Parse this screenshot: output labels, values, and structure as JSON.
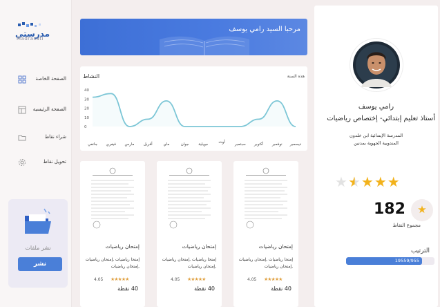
{
  "app": {
    "logo_text": "مدرستي",
    "logo_sub": "Madrasati"
  },
  "sidebar": {
    "items": [
      {
        "label": "الصفحة الخاصة",
        "icon": "grid-icon"
      },
      {
        "label": "الصفحة الرئيسية",
        "icon": "layout-icon"
      },
      {
        "label": "شراء نقاط",
        "icon": "folder-icon"
      },
      {
        "label": "تحويل نقاط",
        "icon": "gear-icon"
      }
    ],
    "upload": {
      "label": "نشر ملفات",
      "button": "نشر"
    }
  },
  "banner": {
    "title": "مرحبا السيد رامي يوسف"
  },
  "activity": {
    "title": "النشاط",
    "filter": "هذه السنة"
  },
  "chart_data": {
    "type": "area",
    "title": "النشاط",
    "categories": [
      "ديسمبر",
      "نوفمبر",
      "أكتوبر",
      "سبتمبر",
      "أوت",
      "جويلية",
      "جوان",
      "ماي",
      "أفريل",
      "مارس",
      "فيفري",
      "جانفي"
    ],
    "values": [
      0,
      28,
      8,
      0,
      0,
      0,
      0,
      28,
      8,
      0,
      36,
      32
    ],
    "yticks": [
      0,
      10,
      20,
      30,
      40
    ],
    "ylim": [
      0,
      40
    ],
    "color": "#7cc6d6",
    "grid": false
  },
  "documents": [
    {
      "title": "إمتحان رياضيات",
      "description": "إمتحا رياضيات ,إمتحان رياضيات ,إمتحان رياضيات",
      "rating": "4.05",
      "stars": "★★★★★",
      "points": "40 نقطة"
    },
    {
      "title": "إمتحان رياضيات",
      "description": "إمتحا رياضيات ,إمتحان رياضيات ,إمتحان رياضيات",
      "rating": "4.05",
      "stars": "★★★★★",
      "points": "40 نقطة"
    },
    {
      "title": "إمتحان رياضيات",
      "description": "إمتحا رياضيات ,إمتحان رياضيات ,إمتحان رياضيات",
      "rating": "4.05",
      "stars": "★★★★★",
      "points": "40 نقطة"
    }
  ],
  "profile": {
    "name": "رامي يوسف",
    "role": "أستاذ تعليم إبتدائي- إختصاص رياضيات",
    "school_line1": "المدرسة الإبتدائية ابن خلدون",
    "school_line2": "المندوبية الجهوية بمدنين",
    "rating_stars": 3.5,
    "points_value": "182",
    "points_label": "مجموع النقاط",
    "rank_title": "الترتيب",
    "rank_text": "19559/955",
    "rank_fraction": 0.86
  },
  "colors": {
    "primary": "#4a7fd8",
    "star": "#f2b21b",
    "chart": "#7cc6d6"
  }
}
